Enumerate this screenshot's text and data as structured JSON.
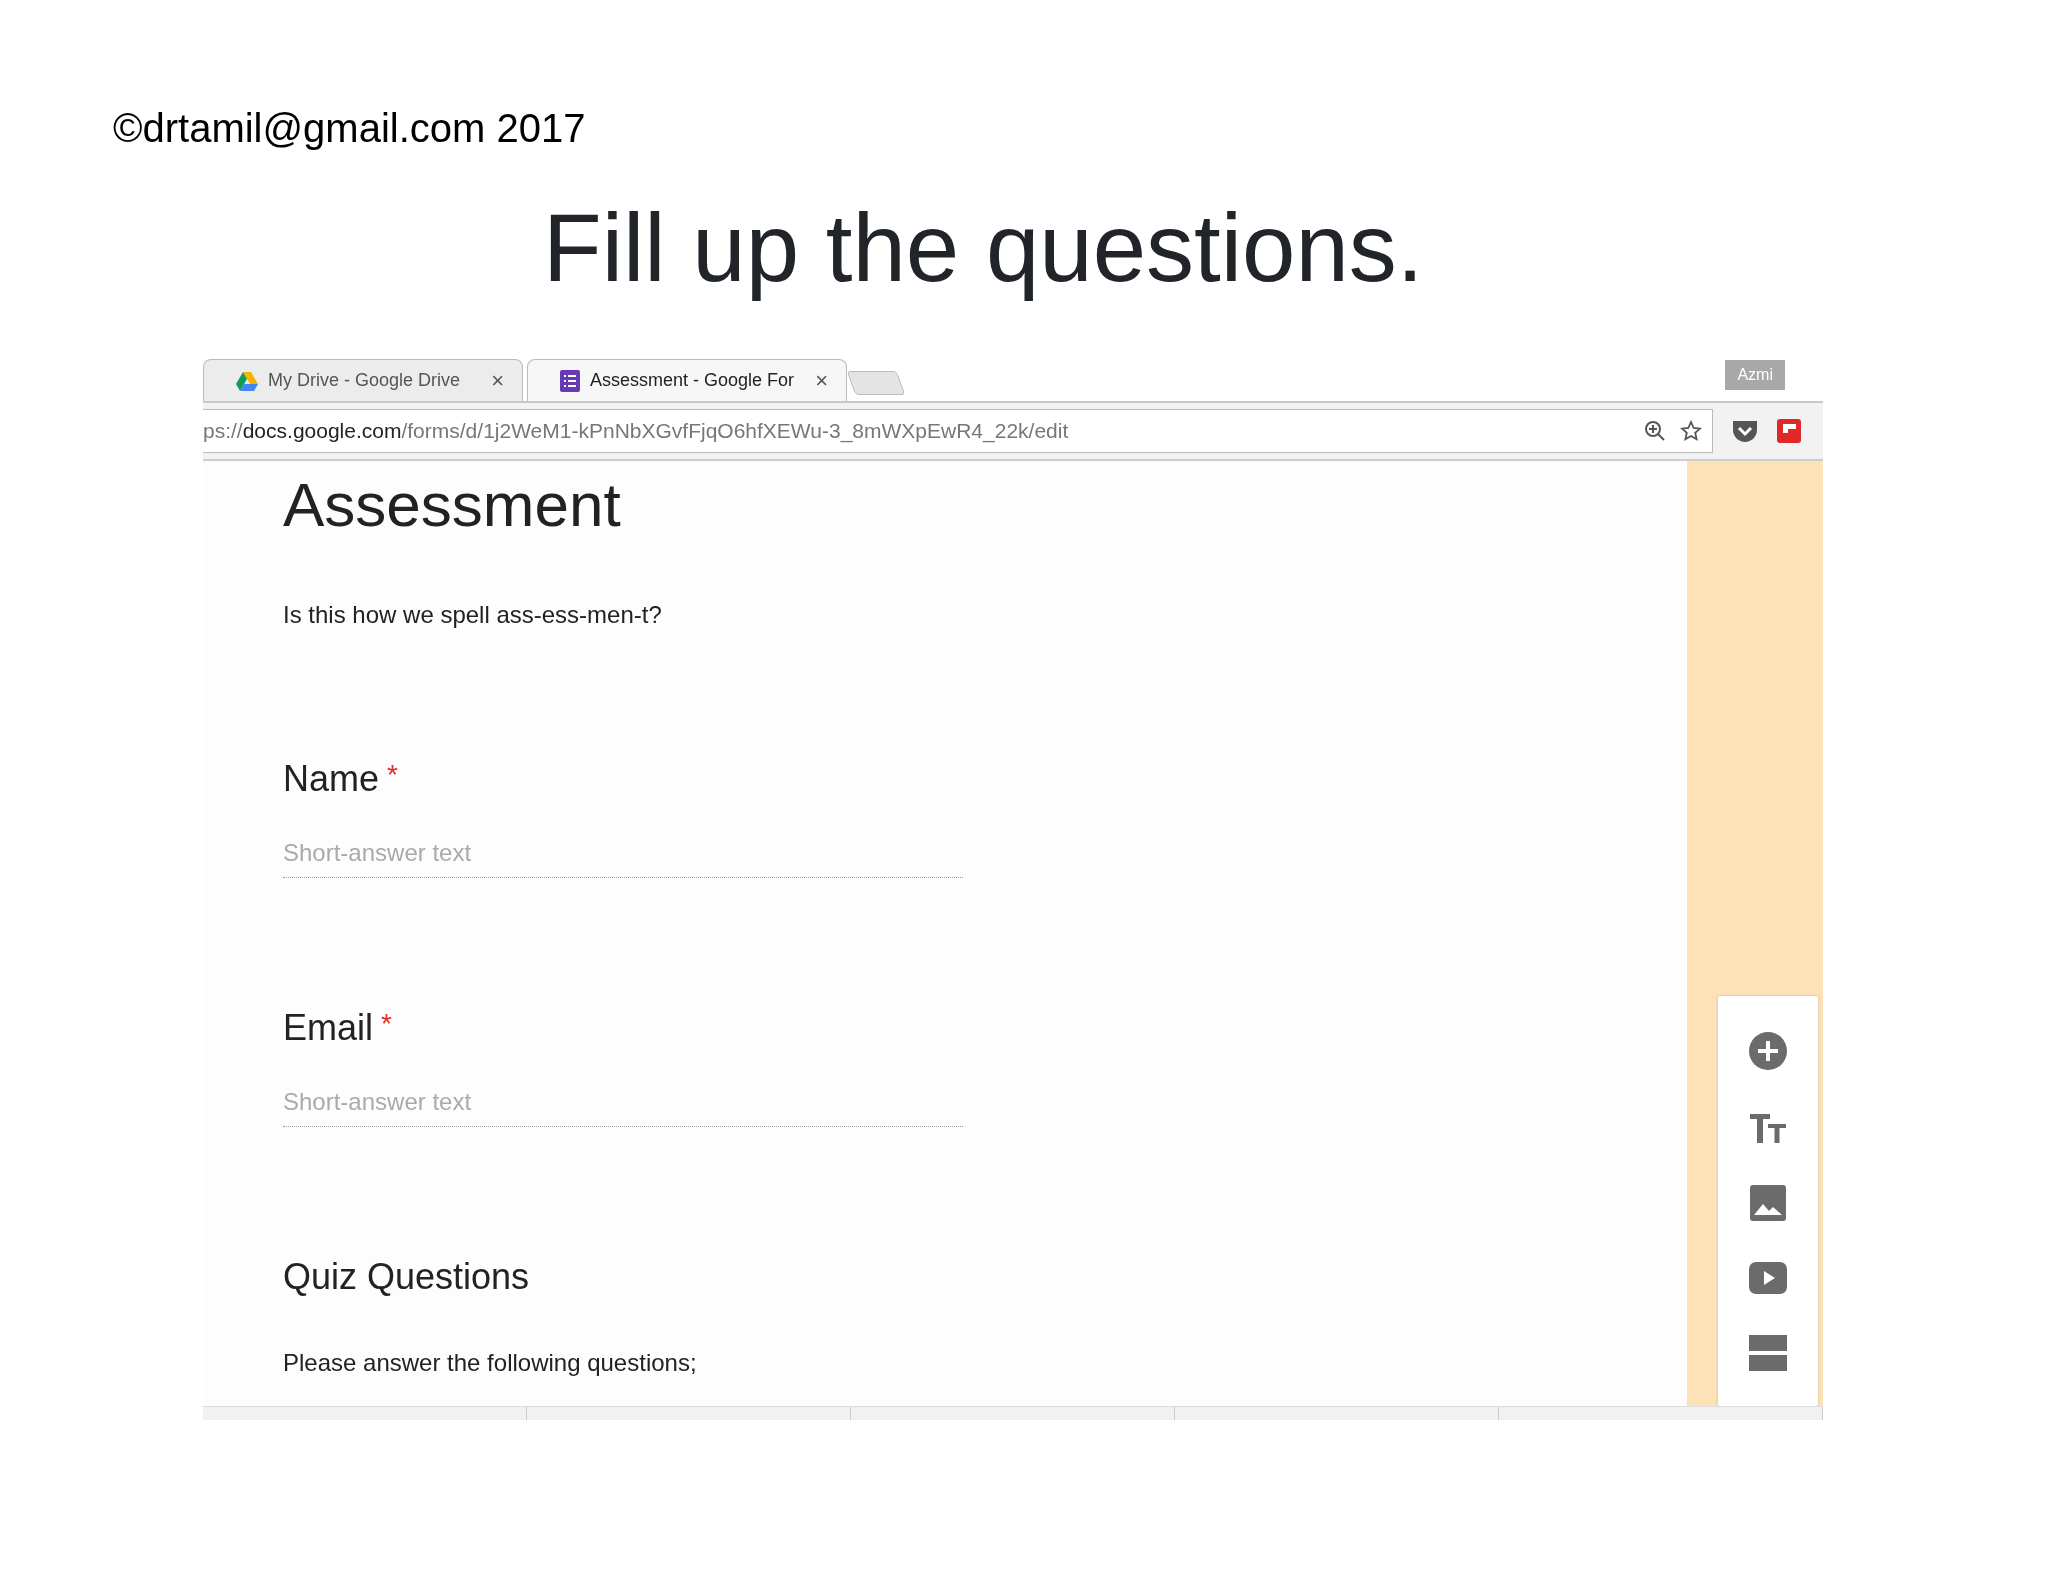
{
  "header": {
    "copyright": "©drtamil@gmail.com 2017",
    "title": "Fill up the questions."
  },
  "browser": {
    "tabs": [
      {
        "kind": "drive",
        "label": "My Drive - Google Drive",
        "close": "×",
        "selected": false
      },
      {
        "kind": "forms",
        "label": "Assessment - Google For",
        "close": "×",
        "selected": true
      }
    ],
    "profile": "Azmi",
    "url": {
      "scheme": "ps://",
      "host": "docs.google.com",
      "path": "/forms/d/1j2WeM1-kPnNbXGvfFjqO6hfXEWu-3_8mWXpEwR4_22k/edit"
    }
  },
  "form": {
    "title": "Assessment",
    "description": "Is this how we spell ass-ess-men-t?",
    "items": [
      {
        "kind": "question",
        "title": "Name",
        "required_mark": "*",
        "placeholder": "Short-answer text"
      },
      {
        "kind": "question",
        "title": "Email",
        "required_mark": "*",
        "placeholder": "Short-answer text"
      },
      {
        "kind": "section",
        "title": "Quiz Questions",
        "description": "Please answer the following questions;"
      }
    ]
  }
}
